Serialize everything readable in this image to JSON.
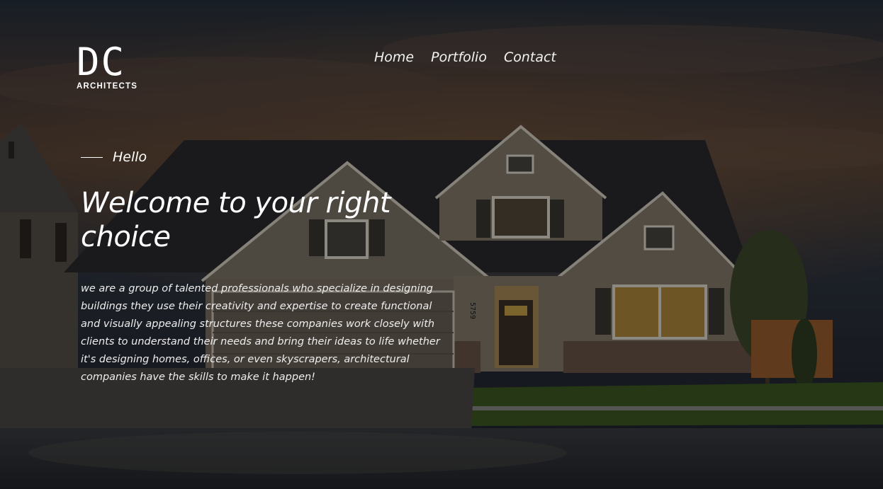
{
  "brand": {
    "logo_mark": "DC",
    "logo_sub": "ARCHITECTS"
  },
  "nav": {
    "home": "Home",
    "portfolio": "Portfolio",
    "contact": "Contact"
  },
  "hero": {
    "eyebrow": "Hello",
    "title": "Welcome to your right choice",
    "description": "we are a group of talented professionals who specialize in designing buildings they use their creativity and expertise to create functional and visually appealing structures these companies work closely with clients to understand their needs and bring their ideas to life whether it's designing homes, offices, or even skyscrapers, architectural companies have the skills to make it happen!",
    "house_number": "5759"
  },
  "colors": {
    "sky_top": "#2a3340",
    "sky_glow": "#8a5a3a",
    "roof": "#2b2b2e",
    "siding": "#8a7f72",
    "window_glow": "#c9a34a",
    "lawn": "#3c5a22"
  }
}
